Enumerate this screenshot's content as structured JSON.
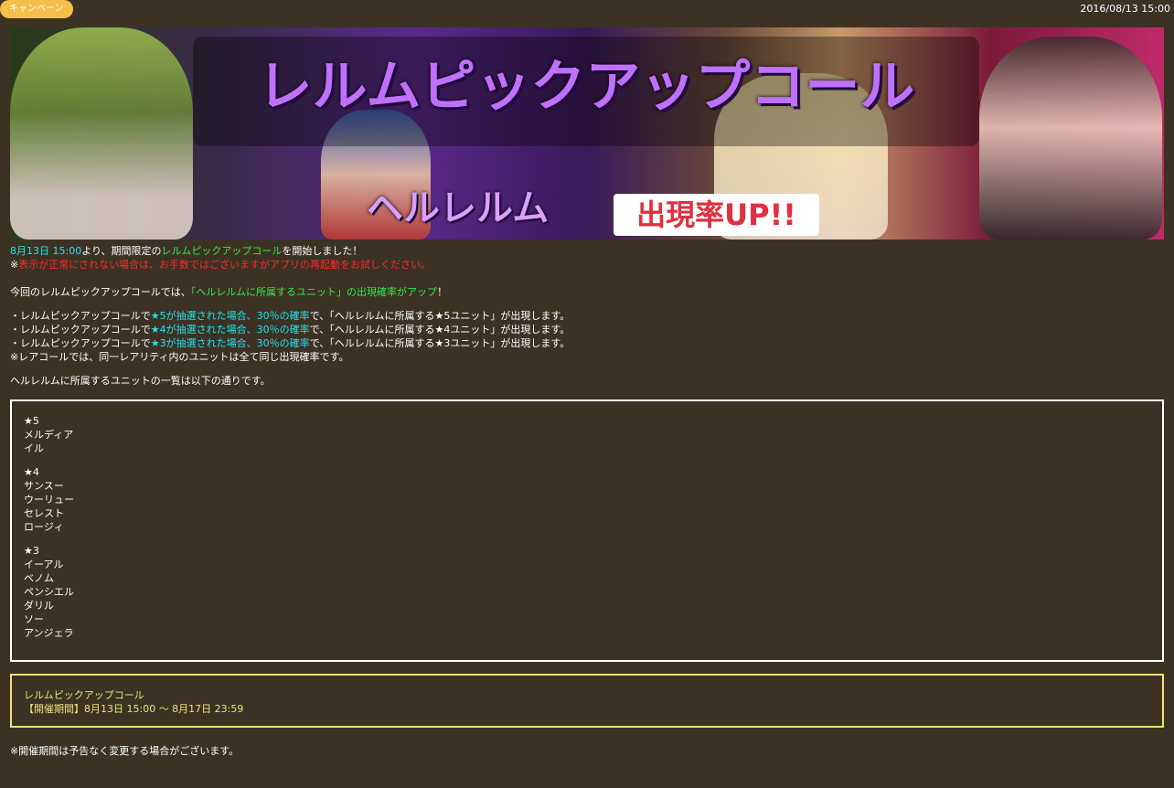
{
  "header": {
    "badge": "キャンペーン",
    "date": "2016/08/13 15:00"
  },
  "banner": {
    "title": "レルムピックアップコール",
    "subtitle": "ヘルレルム",
    "badge": "出現率UP!!"
  },
  "intro": {
    "date_text": "8月13日 15:00",
    "text1": "より、期間限定の",
    "event_name": "レルムピックアップコール",
    "text2": "を開始しました！",
    "note_prefix": "※",
    "note_red": "表示が正常にされない場合は、お手数ではございますがアプリの再起動をお試しください。"
  },
  "description": {
    "text1": "今回のレルムピックアップコールでは、",
    "highlight": "「ヘルレルムに所属するユニット」の出現確率がアップ",
    "text2": "！"
  },
  "rates": [
    {
      "prefix": "・レルムピックアップコールで",
      "highlight": "★5が抽選された場合、30％の確率",
      "suffix": "で、「ヘルレルムに所属する★5ユニット」が出現します。"
    },
    {
      "prefix": "・レルムピックアップコールで",
      "highlight": "★4が抽選された場合、30％の確率",
      "suffix": "で、「ヘルレルムに所属する★4ユニット」が出現します。"
    },
    {
      "prefix": "・レルムピックアップコールで",
      "highlight": "★3が抽選された場合、30％の確率",
      "suffix": "で、「ヘルレルムに所属する★3ユニット」が出現します。"
    }
  ],
  "rate_note": "※レアコールでは、同一レアリティ内のユニットは全て同じ出現確率です。",
  "list_intro": "ヘルレルムに所属するユニットの一覧は以下の通りです。",
  "unit_groups": [
    {
      "rarity": "★5",
      "units": [
        "メルディア",
        "イル"
      ]
    },
    {
      "rarity": "★4",
      "units": [
        "サンスー",
        "ウーリュー",
        "セレスト",
        "ロージィ"
      ]
    },
    {
      "rarity": "★3",
      "units": [
        "イーアル",
        "ベノム",
        "ペンシエル",
        "ダリル",
        "ソー",
        "アンジェラ"
      ]
    }
  ],
  "period_box": {
    "name": "レルムピックアップコール",
    "period": "【開催期間】8月13日 15:00 ～ 8月17日 23:59"
  },
  "footer_note": "※開催期間は予告なく変更する場合がございます。",
  "colors": {
    "background": "#3b3224",
    "accent_cyan": "#26e0f0",
    "accent_green": "#39e84a",
    "warning_red": "#ff2a2a",
    "badge": "#f4c04a",
    "period_border": "#f4e07a"
  }
}
